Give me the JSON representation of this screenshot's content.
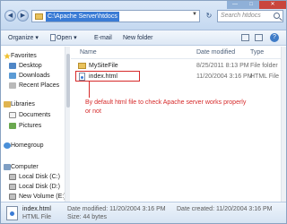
{
  "address": {
    "path": "C:\\Apache Server\\htdocs",
    "search_placeholder": "Search htdocs"
  },
  "toolbar": {
    "organize": "Organize ▾",
    "open": "Open ▾",
    "email": "E-mail",
    "new_folder": "New folder"
  },
  "sidebar": {
    "items": [
      {
        "label": "Favorites",
        "icon": "star-icon"
      },
      {
        "label": "Desktop",
        "icon": "desktop-icon"
      },
      {
        "label": "Downloads",
        "icon": "downloads-icon"
      },
      {
        "label": "Recent Places",
        "icon": "recent-places-icon"
      },
      {
        "label": "Libraries",
        "icon": "libraries-icon"
      },
      {
        "label": "Documents",
        "icon": "documents-icon"
      },
      {
        "label": "Pictures",
        "icon": "pictures-icon"
      },
      {
        "label": "Homegroup",
        "icon": "homegroup-icon"
      },
      {
        "label": "Computer",
        "icon": "computer-icon"
      },
      {
        "label": "Local Disk (C:)",
        "icon": "disk-icon"
      },
      {
        "label": "Local Disk (D:)",
        "icon": "disk-icon"
      },
      {
        "label": "New Volume (E:)",
        "icon": "disk-icon"
      }
    ]
  },
  "filelist": {
    "columns": [
      "Name",
      "Date modified",
      "Type"
    ],
    "rows": [
      {
        "name": "MySiteFile",
        "date": "8/25/2011 8:13 PM",
        "type": "File folder",
        "icon": "folder-icon"
      },
      {
        "name": "index.html",
        "date": "11/20/2004 3:16 PM",
        "type": "HTML File",
        "icon": "html-file-icon"
      }
    ]
  },
  "annotation": "By default html file to check Apache server works properly or not",
  "details": {
    "name": "index.html",
    "type": "HTML File",
    "modified": "Date modified: 11/20/2004 3:16 PM",
    "size": "Size: 44 bytes",
    "created": "Date created: 11/20/2004 3:16 PM"
  },
  "colors": {
    "accent": "#3a7bd5",
    "annotation": "#d62a2a"
  }
}
